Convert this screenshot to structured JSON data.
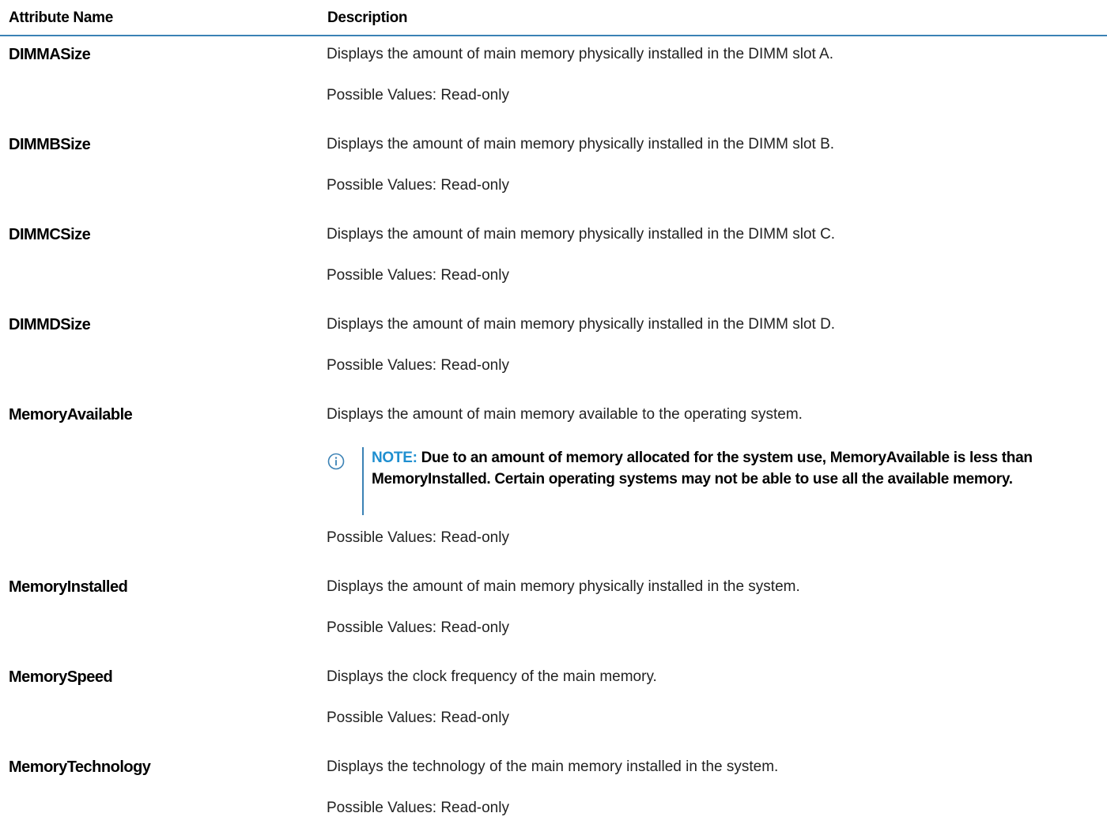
{
  "table": {
    "headers": {
      "name": "Attribute Name",
      "description": "Description"
    },
    "rows": [
      {
        "name": "DIMMASize",
        "description": "Displays the amount of main memory physically installed in the DIMM slot A.",
        "possible": "Possible Values: Read-only"
      },
      {
        "name": "DIMMBSize",
        "description": "Displays the amount of main memory physically installed in the DIMM slot B.",
        "possible": "Possible Values: Read-only"
      },
      {
        "name": "DIMMCSize",
        "description": "Displays the amount of main memory physically installed in the DIMM slot C.",
        "possible": "Possible Values: Read-only"
      },
      {
        "name": "DIMMDSize",
        "description": "Displays the amount of main memory physically installed in the DIMM slot D.",
        "possible": "Possible Values: Read-only"
      },
      {
        "name": "MemoryAvailable",
        "description": "Displays the amount of main memory available to the operating system.",
        "note": {
          "icon": "info-icon",
          "label": "NOTE:",
          "text": " Due to an amount of memory allocated for the system use, MemoryAvailable is less than MemoryInstalled. Certain operating systems may not be able to use all the available memory."
        },
        "possible": "Possible Values: Read-only"
      },
      {
        "name": "MemoryInstalled",
        "description": "Displays the amount of main memory physically installed in the system.",
        "possible": "Possible Values: Read-only"
      },
      {
        "name": "MemorySpeed",
        "description": "Displays the clock frequency of the main memory.",
        "possible": "Possible Values: Read-only"
      },
      {
        "name": "MemoryTechnology",
        "description": "Displays the technology of the main memory installed in the system.",
        "possible": "Possible Values: Read-only"
      }
    ]
  },
  "colors": {
    "accent": "#3b82b5",
    "note_label": "#1f8fd0"
  }
}
